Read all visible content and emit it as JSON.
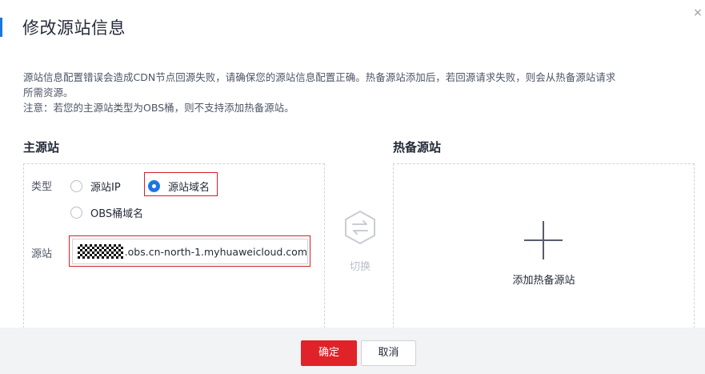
{
  "dialog": {
    "title": "修改源站信息",
    "close_glyph": "×",
    "description": {
      "line1": "源站信息配置错误会造成CDN节点回源失败，请确保您的源站信息配置正确。热备源站添加后，若回源请求失败，则会从热备源站请求",
      "line2": "所需资源。",
      "line3": "注意：若您的主源站类型为OBS桶，则不支持添加热备源站。"
    }
  },
  "primary": {
    "section_title": "主源站",
    "type_label": "类型",
    "type_options": [
      {
        "label": "源站IP",
        "selected": false
      },
      {
        "label": "源站域名",
        "selected": true
      },
      {
        "label": "OBS桶域名",
        "selected": false
      }
    ],
    "origin_label": "源站",
    "origin_value": ".obs.cn-north-1.myhuaweicloud.com"
  },
  "switch": {
    "label": "切换",
    "icon": "switch-arrows-icon"
  },
  "backup": {
    "section_title": "热备源站",
    "add_label": "添加热备源站",
    "icon": "plus-icon"
  },
  "footer": {
    "ok_label": "确定",
    "cancel_label": "取消"
  },
  "colors": {
    "accent": "#1c76e0",
    "primary_button": "#e02229",
    "highlight_border": "#d31f2a"
  }
}
